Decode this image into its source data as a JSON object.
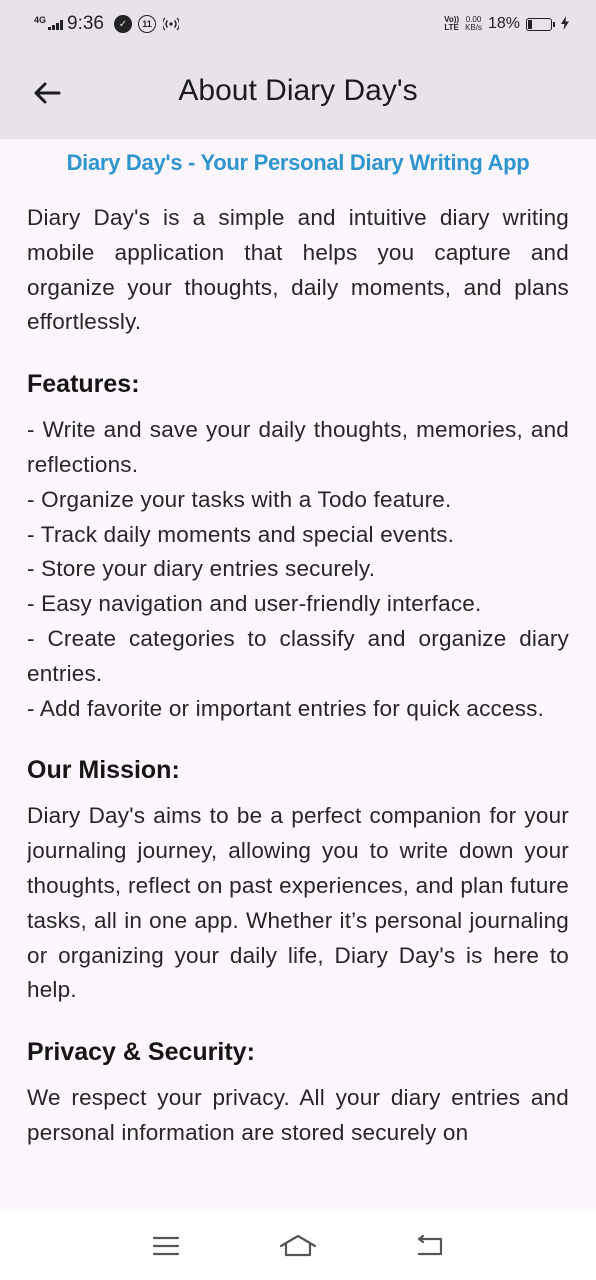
{
  "status_bar": {
    "network": "4G",
    "time": "9:36",
    "volte_line1": "Vo))",
    "volte_line2": "LTE",
    "speed_value": "0.00",
    "speed_unit": "KB/s",
    "battery_percent": "18%",
    "battery_level": 0.18,
    "icons": [
      "signal-icon",
      "check-circle-icon",
      "eleven-badge-icon",
      "hotspot-icon",
      "battery-icon",
      "charging-bolt-icon"
    ]
  },
  "app_bar": {
    "title": "About Diary Day's",
    "back_icon": "arrow-left-icon"
  },
  "content": {
    "subtitle": "Diary Day's - Your Personal Diary Writing App",
    "intro": "Diary Day's is a simple and intuitive diary writing mobile application that helps you capture and organize your thoughts, daily moments, and plans effortlessly.",
    "features_heading": "Features:",
    "features": [
      "- Write and save your daily thoughts, memories, and reflections.",
      "- Organize your tasks with a Todo feature.",
      "- Track daily moments and special events.",
      "- Store your diary entries securely.",
      "- Easy navigation and user-friendly interface.",
      "- Create categories to classify and organize diary entries.",
      "- Add favorite or important entries for quick access."
    ],
    "mission_heading": "Our Mission:",
    "mission": "Diary Day's aims to be a perfect companion for your journaling journey, allowing you to write down your thoughts, reflect on past experiences, and plan future tasks, all in one app. Whether it’s personal journaling or organizing your daily life, Diary Day's is here to help.",
    "privacy_heading": "Privacy & Security:",
    "privacy": "We respect your privacy. All your diary entries and personal information are stored securely on"
  },
  "nav_bar": {
    "icons": [
      "menu-lines-icon",
      "home-icon",
      "back-return-icon"
    ]
  },
  "colors": {
    "background": "#fdf6fd",
    "app_bar": "#e8e3ea",
    "accent": "#2e95cf"
  }
}
